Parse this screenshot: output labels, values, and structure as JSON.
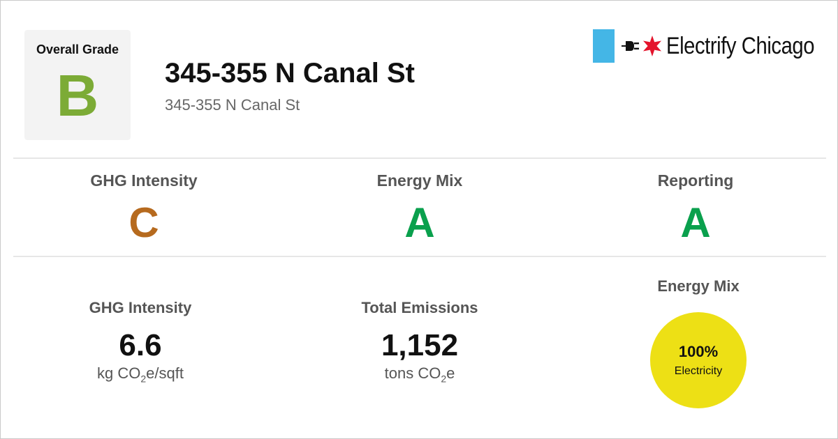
{
  "colors": {
    "grade_B": "#7cab36",
    "grade_C": "#b66a1e",
    "grade_A": "#0aa04d",
    "brand_blue": "#44b6e6",
    "brand_red": "#e4142c",
    "electricity": "#ede015"
  },
  "header": {
    "overall_label": "Overall Grade",
    "overall_grade": "B",
    "title": "345-355 N Canal St",
    "subtitle": "345-355 N Canal St",
    "brand_name": "Electrify Chicago",
    "brand_icons": [
      "plug-icon",
      "star-icon"
    ]
  },
  "grades": [
    {
      "label": "GHG Intensity",
      "grade": "C"
    },
    {
      "label": "Energy Mix",
      "grade": "A"
    },
    {
      "label": "Reporting",
      "grade": "A"
    }
  ],
  "metrics": {
    "ghg": {
      "label": "GHG Intensity",
      "value": "6.6",
      "unit_pre": "kg CO",
      "unit_sub": "2",
      "unit_post": "e/sqft"
    },
    "emissions": {
      "label": "Total Emissions",
      "value": "1,152",
      "unit_pre": "tons CO",
      "unit_sub": "2",
      "unit_post": "e"
    },
    "energy_mix": {
      "label": "Energy Mix",
      "percent": "100%",
      "type": "Electricity",
      "fraction": 1.0
    }
  }
}
